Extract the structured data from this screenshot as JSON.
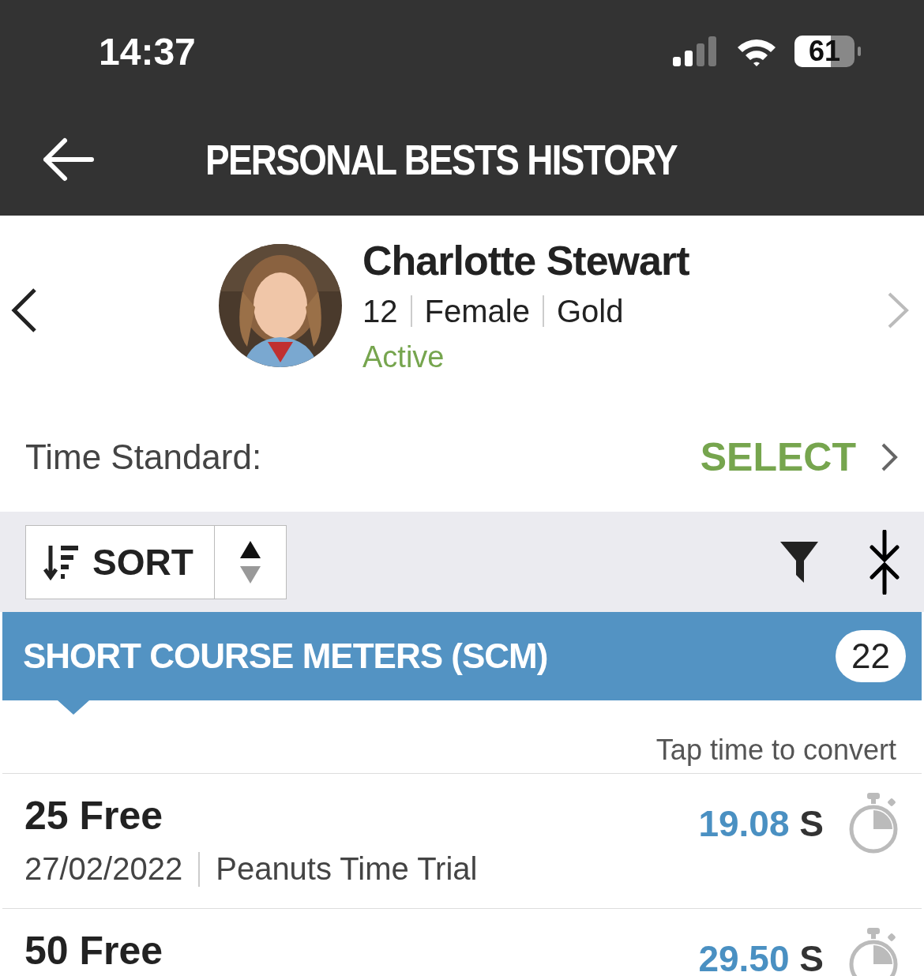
{
  "status_bar": {
    "time": "14:37",
    "battery": "61"
  },
  "header": {
    "title": "PERSONAL BESTS HISTORY"
  },
  "swimmer": {
    "name": "Charlotte Stewart",
    "details": [
      "12",
      "Female",
      "Gold"
    ],
    "status": "Active"
  },
  "time_standard": {
    "label": "Time Standard:",
    "action": "SELECT"
  },
  "toolbar": {
    "sort_label": "SORT"
  },
  "section": {
    "title": "SHORT COURSE METERS (SCM)",
    "count": "22",
    "hint": "Tap time to convert"
  },
  "results": [
    {
      "event": "25 Free",
      "time": "19.08",
      "unit": "S",
      "date": "27/02/2022",
      "meet": "Peanuts Time Trial"
    },
    {
      "event": "50 Free",
      "time": "29.50",
      "unit": "S"
    }
  ]
}
